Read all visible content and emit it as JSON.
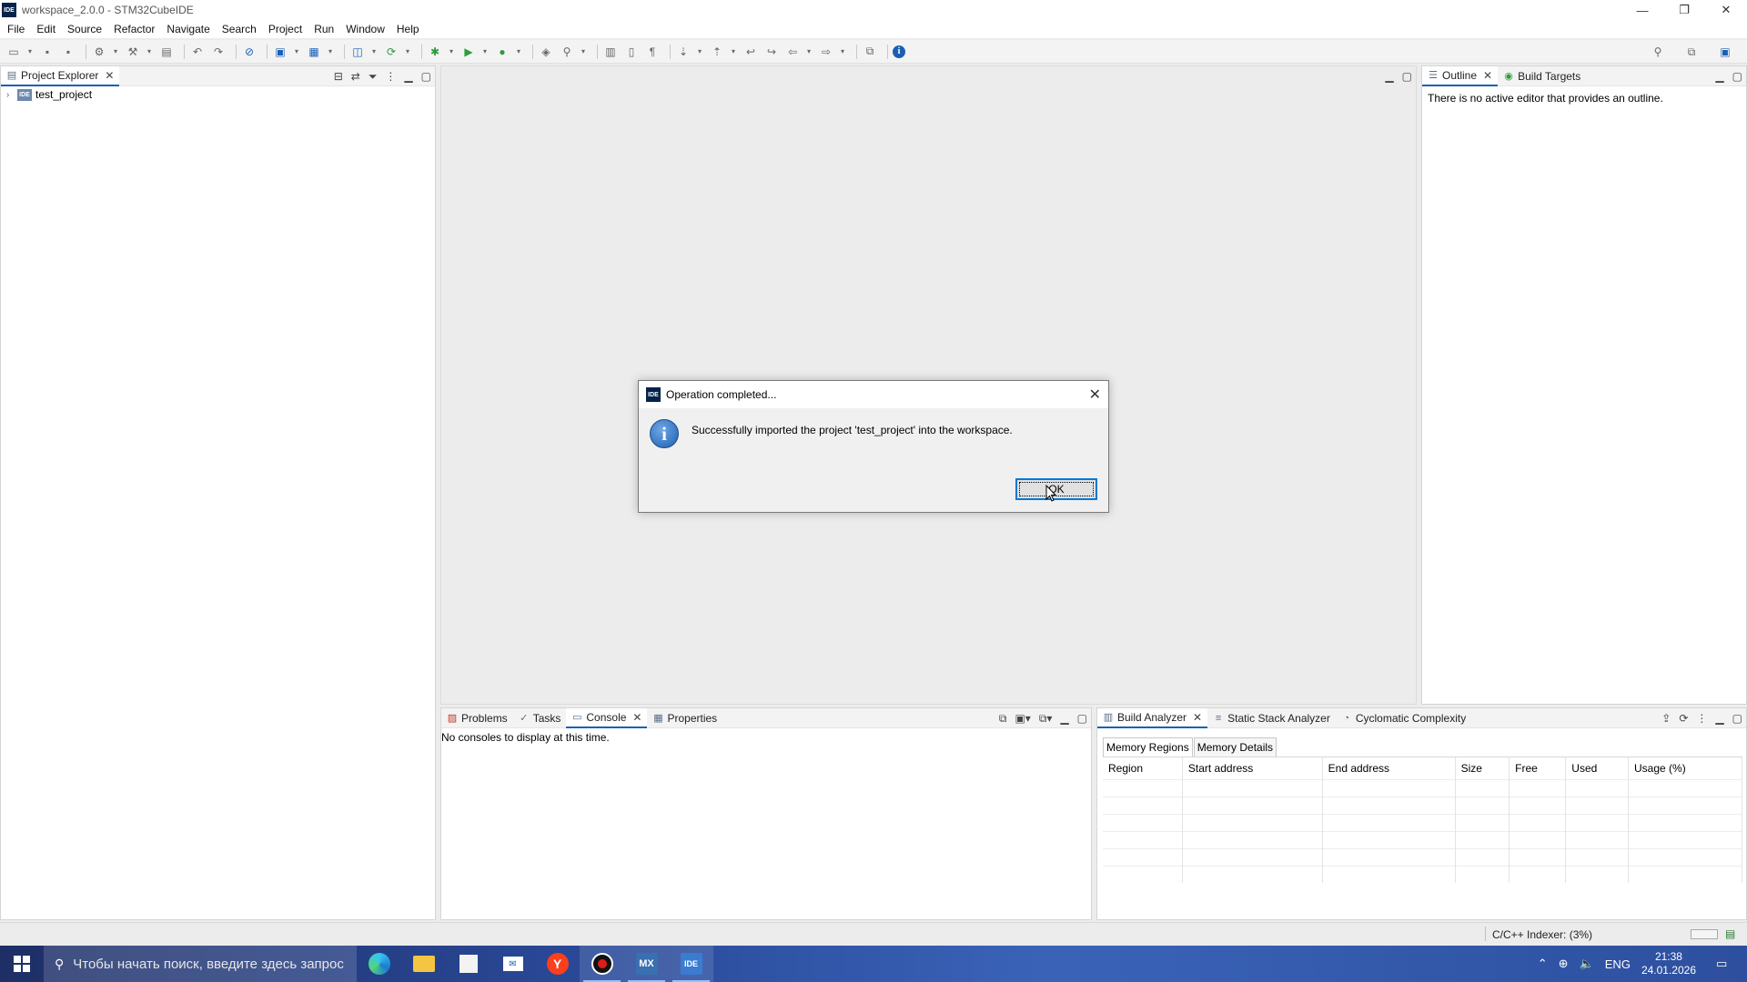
{
  "window": {
    "title": "workspace_2.0.0 - STM32CubeIDE",
    "logo_text": "IDE",
    "controls": {
      "minimize": "—",
      "restore": "❐",
      "close": "✕"
    }
  },
  "menu": [
    "File",
    "Edit",
    "Source",
    "Refactor",
    "Navigate",
    "Search",
    "Project",
    "Run",
    "Window",
    "Help"
  ],
  "project_explorer": {
    "tab_label": "Project Explorer",
    "items": [
      {
        "label": "test_project",
        "icon_text": "IDE"
      }
    ]
  },
  "outline_pane": {
    "tabs": [
      "Outline",
      "Build Targets"
    ],
    "message": "There is no active editor that provides an outline."
  },
  "console_pane": {
    "tabs": [
      "Problems",
      "Tasks",
      "Console",
      "Properties"
    ],
    "message": "No consoles to display at this time."
  },
  "build_analyzer": {
    "tabs": [
      "Build Analyzer",
      "Static Stack Analyzer",
      "Cyclomatic Complexity"
    ],
    "subtabs": [
      "Memory Regions",
      "Memory Details"
    ],
    "columns": [
      "Region",
      "Start address",
      "End address",
      "Size",
      "Free",
      "Used",
      "Usage (%)"
    ]
  },
  "status_bar": {
    "indexer": "C/C++ Indexer: (3%)"
  },
  "dialog": {
    "title": "Operation completed...",
    "logo_text": "IDE",
    "message": "Successfully imported the project 'test_project' into the workspace.",
    "ok_label": "OK"
  },
  "taskbar": {
    "search_placeholder": "Чтобы начать поиск, введите здесь запрос",
    "apps": [
      {
        "name": "edge",
        "label": ""
      },
      {
        "name": "explorer",
        "label": ""
      },
      {
        "name": "store",
        "label": ""
      },
      {
        "name": "mail",
        "label": "✉"
      },
      {
        "name": "yandex",
        "label": "Y"
      },
      {
        "name": "recorder",
        "label": ""
      },
      {
        "name": "stm32cubemx",
        "label": "MX"
      },
      {
        "name": "stm32cubeide",
        "label": "IDE"
      }
    ],
    "language": "ENG",
    "time": "21:38",
    "date": "24.01.2026"
  }
}
